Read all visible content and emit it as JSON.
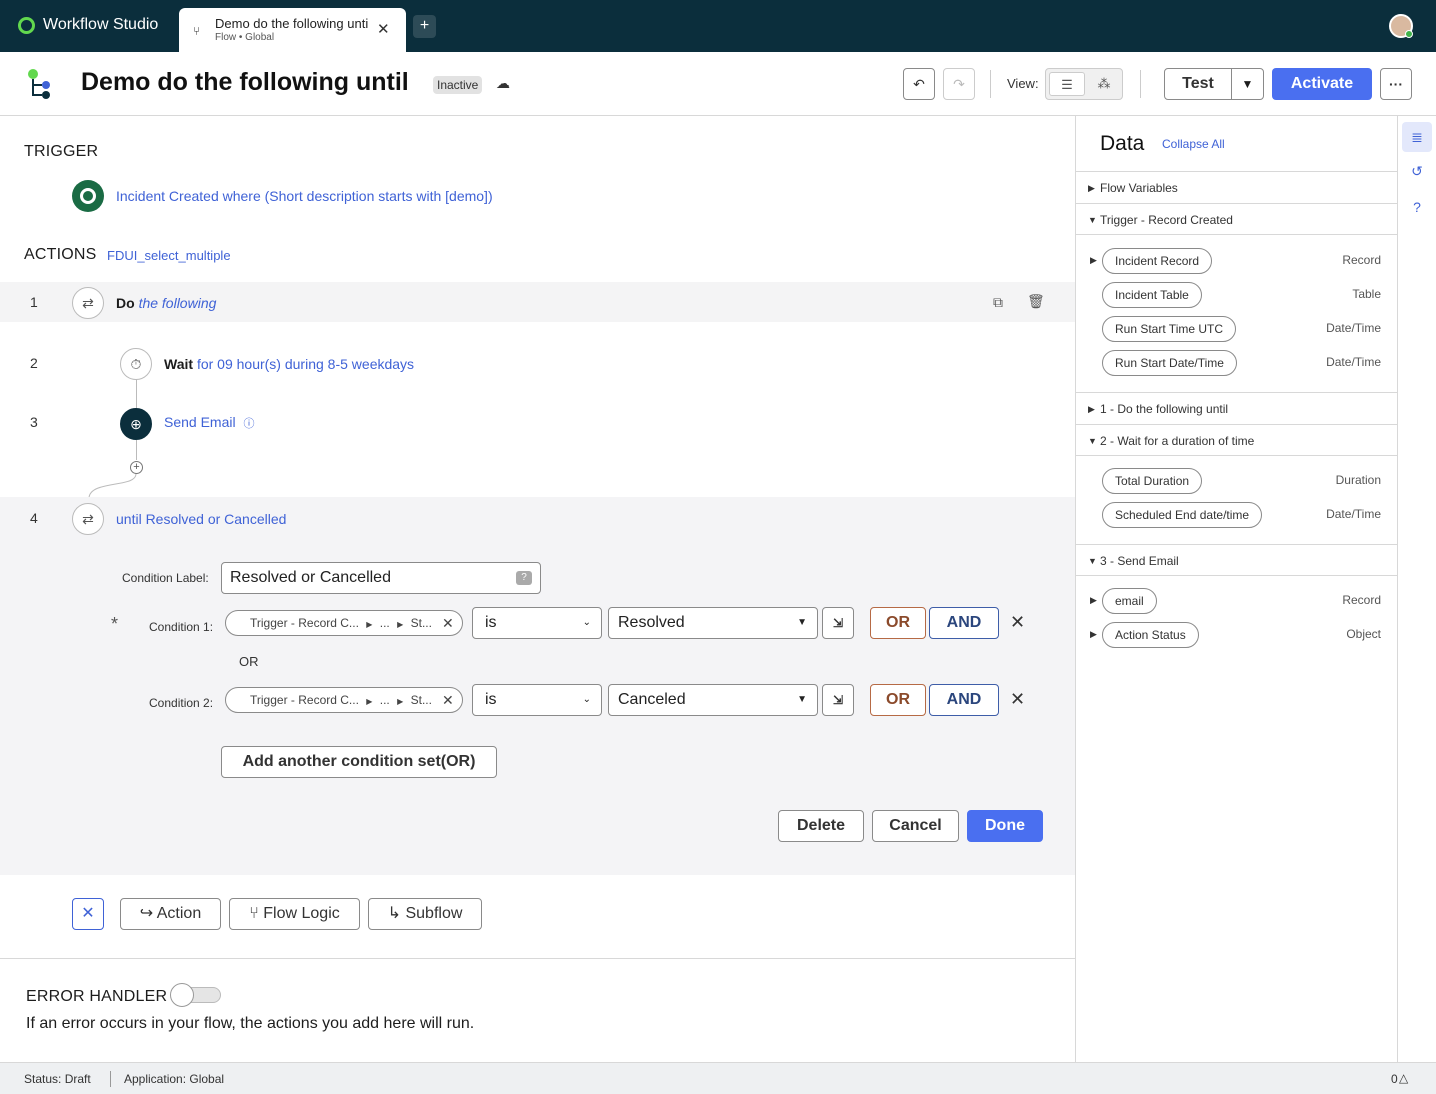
{
  "app": {
    "brand": "Workflow Studio"
  },
  "tab": {
    "title": "Demo do the following until",
    "subtitle": "Flow • Global",
    "new_tab": "+"
  },
  "header": {
    "title": "Demo do the following until",
    "status_badge": "Inactive",
    "view_label": "View:",
    "test_label": "Test",
    "activate_label": "Activate",
    "more_label": "···"
  },
  "trigger": {
    "section_title": "TRIGGER",
    "description": "Incident Created where (Short description starts with [demo])"
  },
  "actions": {
    "section_title": "ACTIONS",
    "tag": "FDUI_select_multiple",
    "steps": [
      {
        "num": "1",
        "keyword": "Do",
        "text": "the following"
      },
      {
        "num": "2",
        "keyword": "Wait",
        "text": "for 09 hour(s) during 8-5 weekdays"
      },
      {
        "num": "3",
        "keyword": "",
        "text": "Send Email"
      },
      {
        "num": "4",
        "keyword": "",
        "text": "until Resolved or Cancelled"
      }
    ]
  },
  "condition_form": {
    "label_caption": "Condition Label:",
    "label_value": "Resolved or Cancelled",
    "required_mark": "*",
    "or_separator": "OR",
    "conditions": [
      {
        "caption": "Condition 1:",
        "pill_parts": [
          "Trigger - Record C...",
          "...",
          "St..."
        ],
        "operator": "is",
        "value": "Resolved",
        "or": "OR",
        "and": "AND"
      },
      {
        "caption": "Condition 2:",
        "pill_parts": [
          "Trigger - Record C...",
          "...",
          "St..."
        ],
        "operator": "is",
        "value": "Canceled",
        "or": "OR",
        "and": "AND"
      }
    ],
    "add_set_label": "Add another condition set(OR)",
    "delete_label": "Delete",
    "cancel_label": "Cancel",
    "done_label": "Done"
  },
  "add_bar": {
    "action_label": "Action",
    "flow_logic_label": "Flow Logic",
    "subflow_label": "Subflow"
  },
  "error_handler": {
    "title": "ERROR HANDLER",
    "description": "If an error occurs in your flow, the actions you add here will run.",
    "enabled": false
  },
  "data_panel": {
    "title": "Data",
    "collapse_all": "Collapse All",
    "sections": [
      {
        "label": "Flow Variables",
        "expanded": false
      },
      {
        "label": "Trigger - Record Created",
        "expanded": true,
        "items": [
          {
            "label": "Incident Record",
            "type": "Record",
            "expandable": true
          },
          {
            "label": "Incident Table",
            "type": "Table",
            "expandable": false
          },
          {
            "label": "Run Start Time UTC",
            "type": "Date/Time",
            "expandable": false
          },
          {
            "label": "Run Start Date/Time",
            "type": "Date/Time",
            "expandable": false
          }
        ]
      },
      {
        "label": "1 - Do the following until",
        "expanded": false
      },
      {
        "label": "2 - Wait for a duration of time",
        "expanded": true,
        "items": [
          {
            "label": "Total Duration",
            "type": "Duration",
            "expandable": false
          },
          {
            "label": "Scheduled End date/time",
            "type": "Date/Time",
            "expandable": false
          }
        ]
      },
      {
        "label": "3 - Send Email",
        "expanded": true,
        "items": [
          {
            "label": "email",
            "type": "Record",
            "expandable": true
          },
          {
            "label": "Action Status",
            "type": "Object",
            "expandable": true
          }
        ]
      }
    ]
  },
  "status_bar": {
    "status": "Status: Draft",
    "application": "Application: Global",
    "notifications": "0"
  },
  "colors": {
    "topbar": "#0b2e3c",
    "accent": "#4a6ff0",
    "link": "#3f62d6",
    "brand_green": "#62d84e"
  }
}
